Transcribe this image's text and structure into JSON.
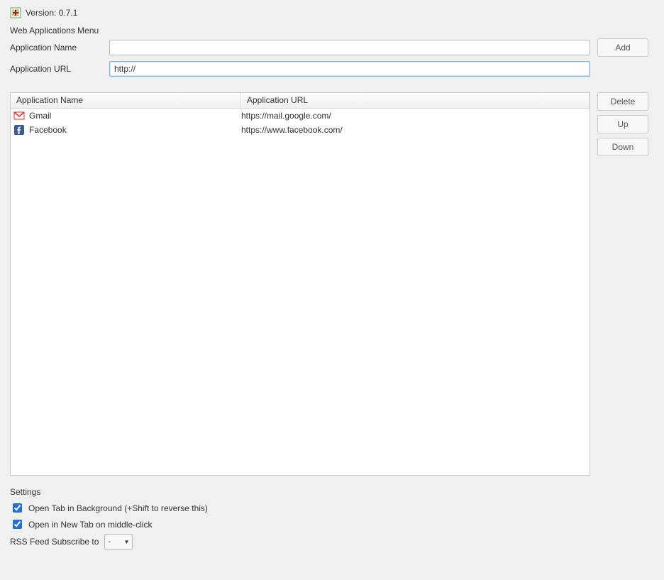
{
  "header": {
    "version_label": "Version: 0.7.1"
  },
  "menu": {
    "title": "Web Applications Menu",
    "name_label": "Application Name",
    "url_label": "Application URL",
    "name_value": "",
    "url_value": "http://",
    "add_button": "Add"
  },
  "list": {
    "columns": {
      "name": "Application Name",
      "url": "Application URL"
    },
    "rows": [
      {
        "icon": "gmail",
        "name": "Gmail",
        "url": "https://mail.google.com/"
      },
      {
        "icon": "facebook",
        "name": "Facebook",
        "url": "https://www.facebook.com/"
      }
    ]
  },
  "side": {
    "delete": "Delete",
    "up": "Up",
    "down": "Down"
  },
  "settings": {
    "title": "Settings",
    "open_bg": {
      "checked": true,
      "label": "Open Tab in Background (+Shift to reverse this)"
    },
    "open_new": {
      "checked": true,
      "label": "Open in New Tab on middle-click"
    },
    "rss_label": "RSS Feed Subscribe to",
    "rss_value": "-"
  }
}
